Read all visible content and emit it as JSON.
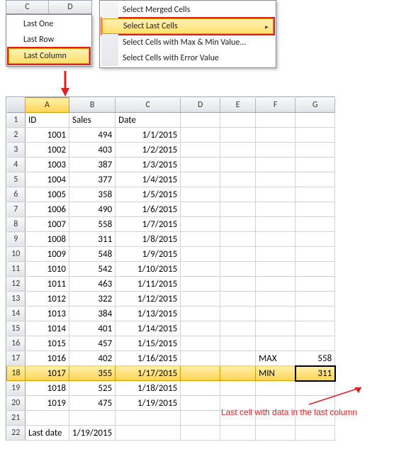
{
  "top_headers": {
    "c": "C",
    "d": "D"
  },
  "dropdown": {
    "items": [
      {
        "label": "Last One"
      },
      {
        "label": "Last Row"
      },
      {
        "label": "Last Column",
        "highlight": true
      }
    ]
  },
  "ctxmenu": {
    "items": [
      {
        "label": "Select Merged Cells"
      },
      {
        "label": "Select Last Cells",
        "highlight": true,
        "has_sub": true
      },
      {
        "label": "Select Cells with Max & Min Value..."
      },
      {
        "label": "Select Cells with Error Value"
      }
    ]
  },
  "columns": [
    "A",
    "B",
    "C",
    "D",
    "E",
    "F",
    "G"
  ],
  "headers": {
    "A": "ID",
    "B": "Sales",
    "C": "Date"
  },
  "summary": {
    "max_label": "MAX",
    "max_value": "558",
    "min_label": "MIN",
    "min_value": "311"
  },
  "rows": [
    {
      "id": "1001",
      "sales": "494",
      "date": "1/1/2015"
    },
    {
      "id": "1002",
      "sales": "403",
      "date": "1/2/2015"
    },
    {
      "id": "1003",
      "sales": "387",
      "date": "1/3/2015"
    },
    {
      "id": "1004",
      "sales": "377",
      "date": "1/4/2015"
    },
    {
      "id": "1005",
      "sales": "358",
      "date": "1/5/2015"
    },
    {
      "id": "1006",
      "sales": "490",
      "date": "1/6/2015"
    },
    {
      "id": "1007",
      "sales": "558",
      "date": "1/7/2015"
    },
    {
      "id": "1008",
      "sales": "311",
      "date": "1/8/2015"
    },
    {
      "id": "1009",
      "sales": "548",
      "date": "1/9/2015"
    },
    {
      "id": "1010",
      "sales": "542",
      "date": "1/10/2015"
    },
    {
      "id": "1011",
      "sales": "463",
      "date": "1/11/2015"
    },
    {
      "id": "1012",
      "sales": "322",
      "date": "1/12/2015"
    },
    {
      "id": "1013",
      "sales": "384",
      "date": "1/13/2015"
    },
    {
      "id": "1014",
      "sales": "401",
      "date": "1/14/2015"
    },
    {
      "id": "1015",
      "sales": "457",
      "date": "1/15/2015"
    },
    {
      "id": "1016",
      "sales": "402",
      "date": "1/16/2015"
    },
    {
      "id": "1017",
      "sales": "355",
      "date": "1/17/2015"
    },
    {
      "id": "1018",
      "sales": "525",
      "date": "1/18/2015"
    },
    {
      "id": "1019",
      "sales": "475",
      "date": "1/19/2015"
    }
  ],
  "lastdate": {
    "label": "Last date",
    "value": "1/19/2015"
  },
  "annotation": "Last cell with data in the last column"
}
